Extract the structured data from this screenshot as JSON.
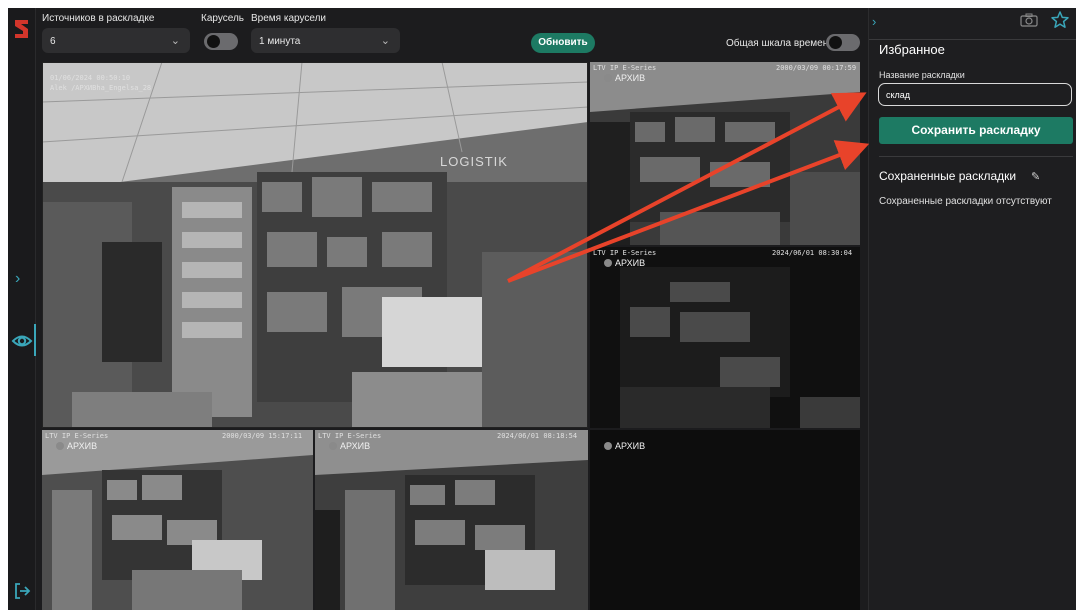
{
  "toolbar": {
    "sources_label": "Источников в раскладке",
    "sources_value": "6",
    "carousel_label": "Карусель",
    "carousel_time_label": "Время карусели",
    "carousel_time_value": "1 минута",
    "refresh_label": "Обновить",
    "timeline_label": "Общая шкала времени"
  },
  "cameras": [
    {
      "overlay_line1": "01/06/2024 00:50:10",
      "overlay_line2": "Alek  /АРХИВha_Engelsa_28"
    },
    {
      "overlay_left": "LTV IP E-Series",
      "overlay_right": "2000/03/09 00:17:59",
      "archive": "АРХИВ"
    },
    {
      "overlay_left": "LTV IP E-Series",
      "overlay_right": "2024/06/01 08:30:04",
      "archive": "АРХИВ"
    },
    {
      "overlay_left": "LTV IP E-Series",
      "overlay_right": "2000/03/09 15:17:11",
      "archive": "АРХИВ"
    },
    {
      "overlay_left": "LTV IP E-Series",
      "overlay_right": "2024/06/01 08:18:54",
      "archive": "АРХИВ"
    },
    {
      "archive": "АРХИВ"
    }
  ],
  "sign_text": "LOGISTIK",
  "panel": {
    "title": "Избранное",
    "layout_name_label": "Название раскладки",
    "layout_name_value": "склад",
    "save_button": "Сохранить раскладку",
    "saved_title": "Сохраненные раскладки",
    "saved_empty": "Сохраненные раскладки отсутствуют"
  },
  "colors": {
    "accent": "#1d7a63",
    "highlight": "#3aa6b9",
    "annotation": "#e8432a"
  },
  "icons": [
    "app-logo-icon",
    "chevron-right-icon",
    "eye-icon",
    "exit-icon",
    "chevron-down-icon",
    "camera-icon",
    "star-icon",
    "pencil-icon"
  ]
}
